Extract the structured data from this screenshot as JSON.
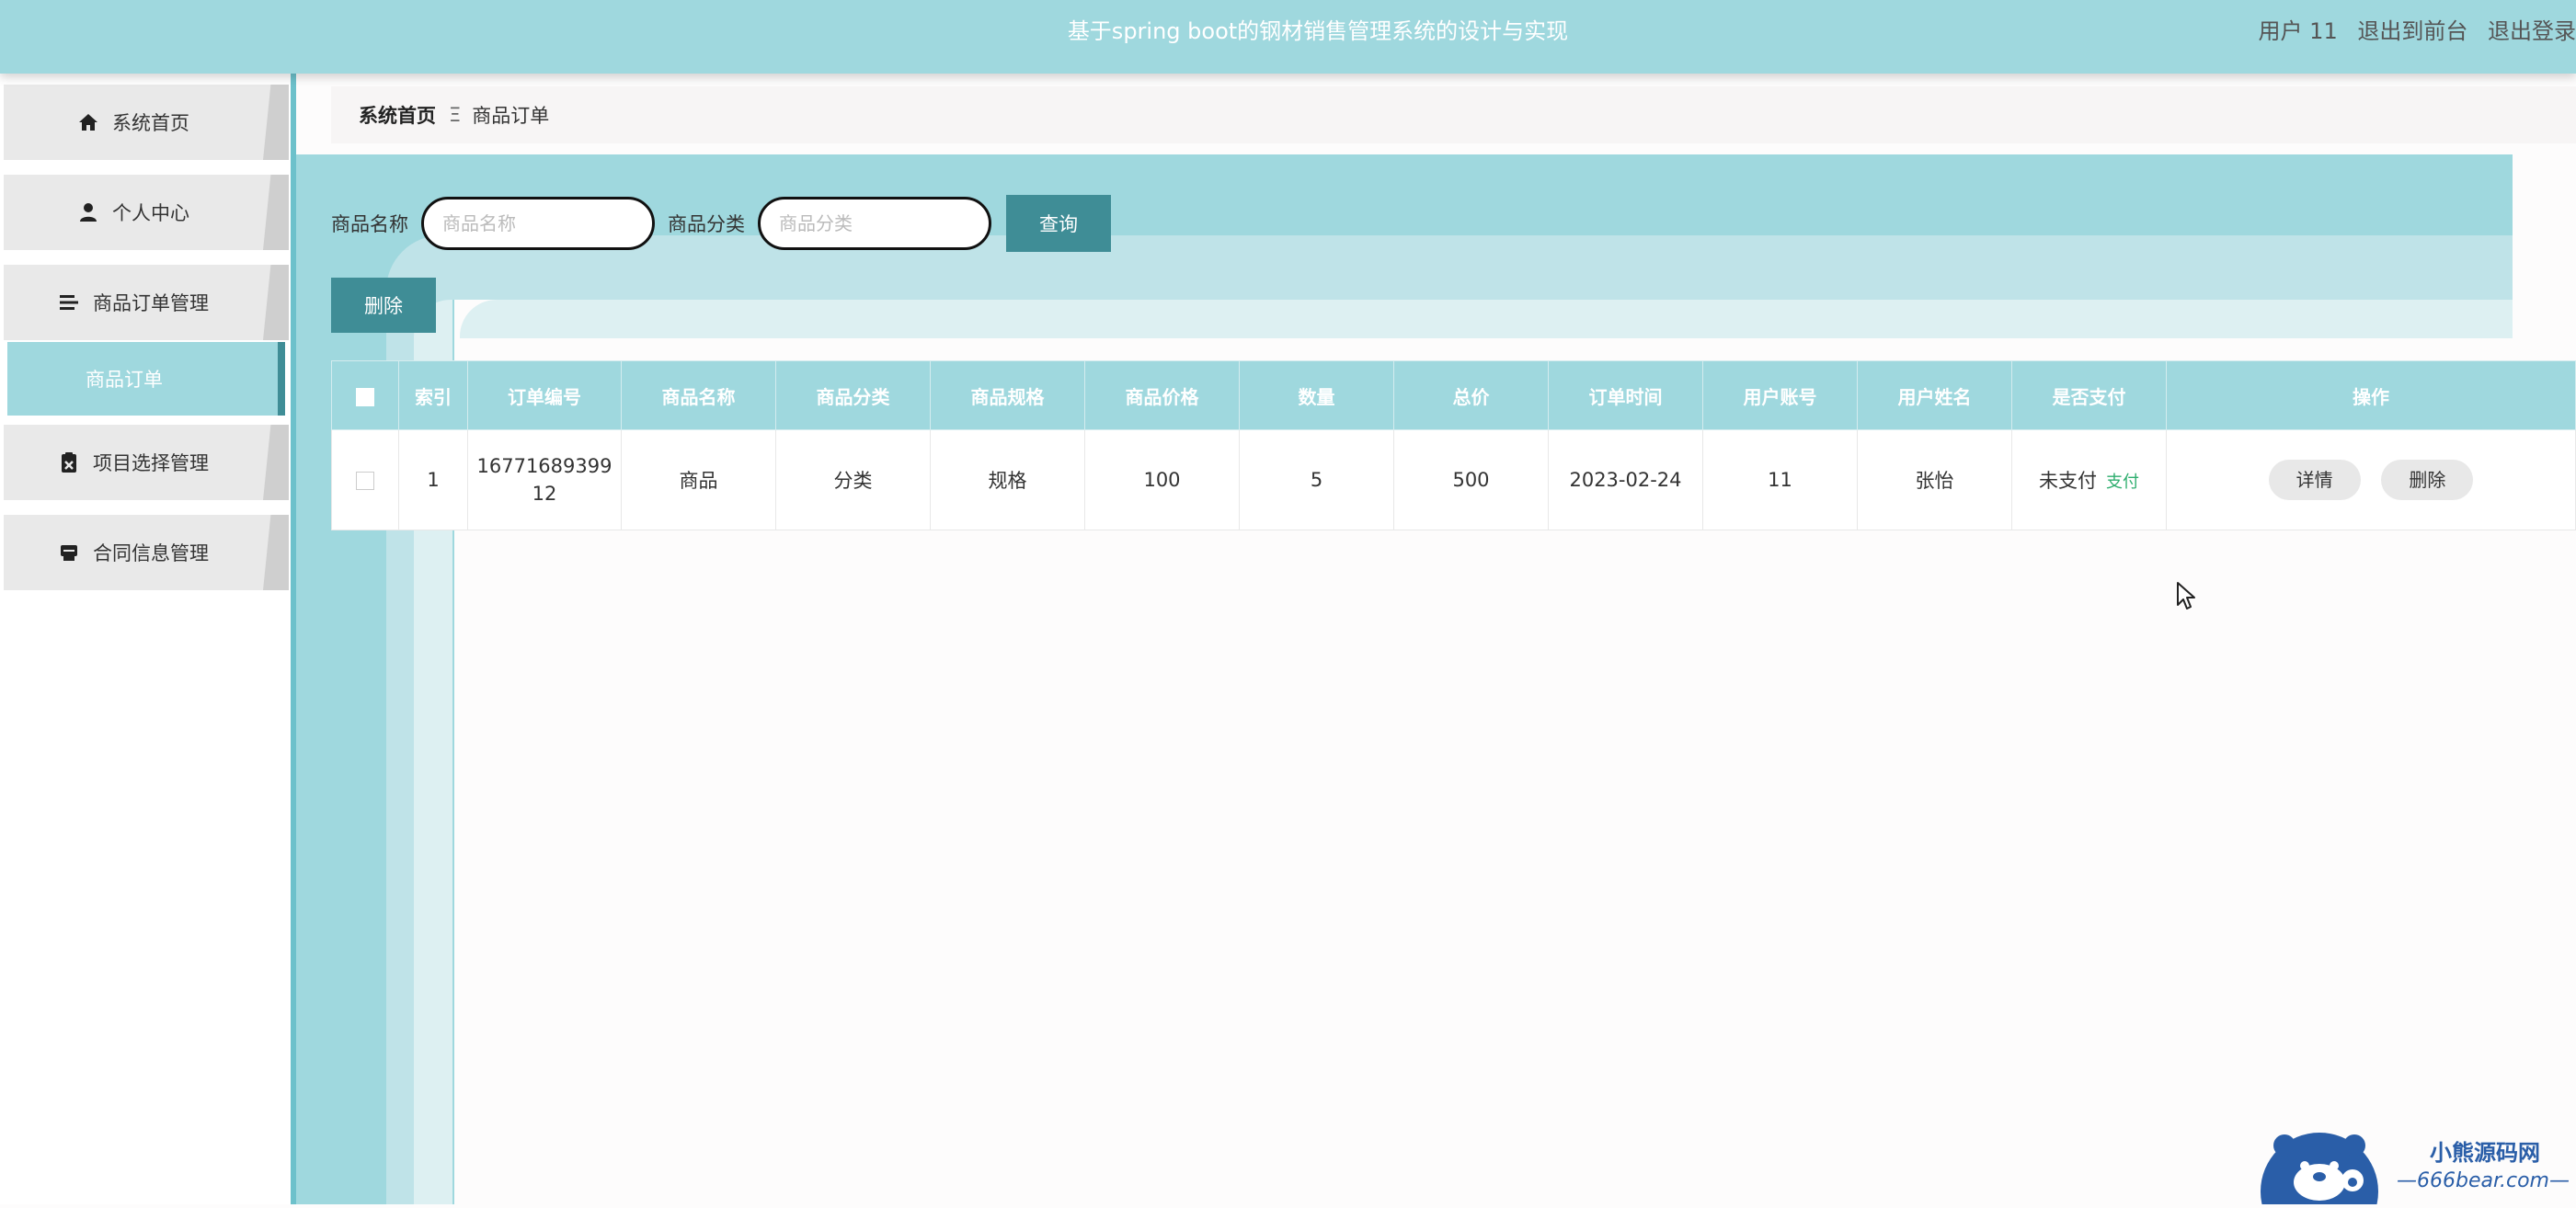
{
  "header": {
    "title": "基于spring boot的钢材销售管理系统的设计与实现",
    "user": "用户 11",
    "to_frontend": "退出到前台",
    "logout": "退出登录"
  },
  "sidebar": {
    "items": [
      {
        "label": "系统首页",
        "icon": "home-icon"
      },
      {
        "label": "个人中心",
        "icon": "user-icon"
      },
      {
        "label": "商品订单管理",
        "icon": "menu-icon"
      },
      {
        "label": "项目选择管理",
        "icon": "clipboard-icon"
      },
      {
        "label": "合同信息管理",
        "icon": "printer-icon"
      }
    ],
    "active_sub": "商品订单"
  },
  "breadcrumb": {
    "home": "系统首页",
    "separator": "Ξ",
    "current": "商品订单"
  },
  "search": {
    "name_label": "商品名称",
    "name_placeholder": "商品名称",
    "name_value": "",
    "category_label": "商品分类",
    "category_placeholder": "商品分类",
    "category_value": "",
    "query_button": "查询"
  },
  "actions": {
    "delete_button": "删除"
  },
  "table": {
    "headers": [
      "索引",
      "订单编号",
      "商品名称",
      "商品分类",
      "商品规格",
      "商品价格",
      "数量",
      "总价",
      "订单时间",
      "用户账号",
      "用户姓名",
      "是否支付",
      "操作"
    ],
    "rows": [
      {
        "index": "1",
        "order_no_line1": "16771689399",
        "order_no_line2": "12",
        "product_name": "商品",
        "category": "分类",
        "spec": "规格",
        "price": "100",
        "quantity": "5",
        "total": "500",
        "order_time": "2023-02-24",
        "account": "11",
        "user_name": "张怡",
        "pay_status": "未支付",
        "pay_link": "支付",
        "detail_button": "详情",
        "delete_button": "删除"
      }
    ]
  },
  "watermark": {
    "title": "小熊源码网",
    "url": "—666bear.com—"
  },
  "colors": {
    "accent": "#9fd8de",
    "dark_accent": "#3f8d96",
    "pay_link": "#2fae6f"
  }
}
